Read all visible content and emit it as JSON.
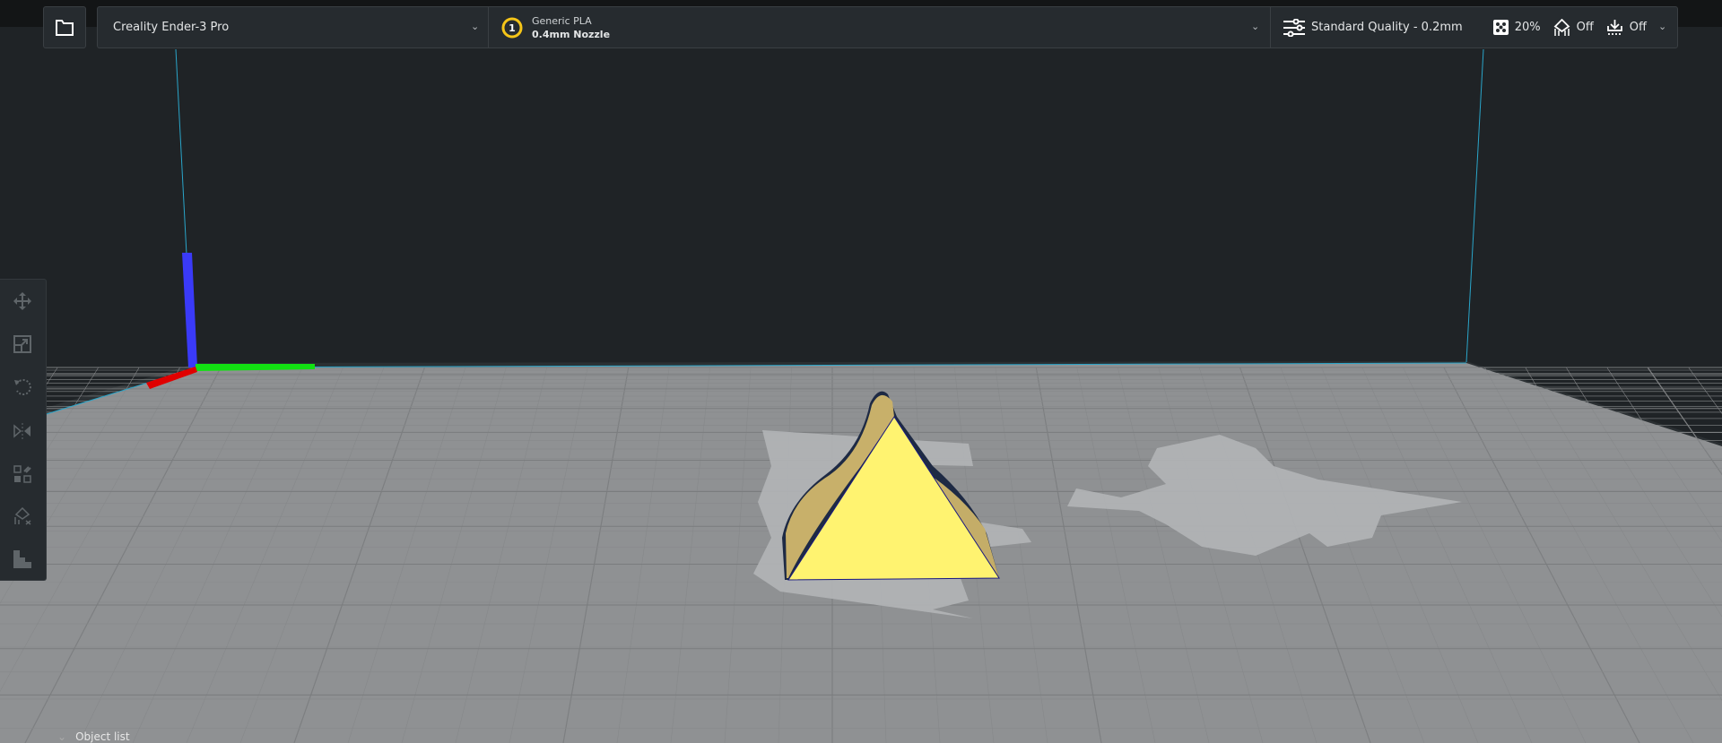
{
  "header": {
    "printer": "Creality Ender-3 Pro",
    "material": {
      "extruder_number": "1",
      "name": "Generic PLA",
      "nozzle": "0.4mm Nozzle"
    },
    "settings": {
      "profile": "Standard Quality - 0.2mm",
      "infill": "20%",
      "support": "Off",
      "adhesion": "Off"
    }
  },
  "toolbar": {
    "items": [
      "move",
      "scale",
      "rotate",
      "mirror",
      "per-model-settings",
      "support-blocker",
      "lay-flat"
    ]
  },
  "object_list": {
    "label": "Object list"
  },
  "colors": {
    "model": "#fff370",
    "extruder_badge": "#f5c518",
    "axis_x": "#e00000",
    "axis_y": "#00e000",
    "axis_z": "#3030ff",
    "build_plate": "#8f9193"
  }
}
